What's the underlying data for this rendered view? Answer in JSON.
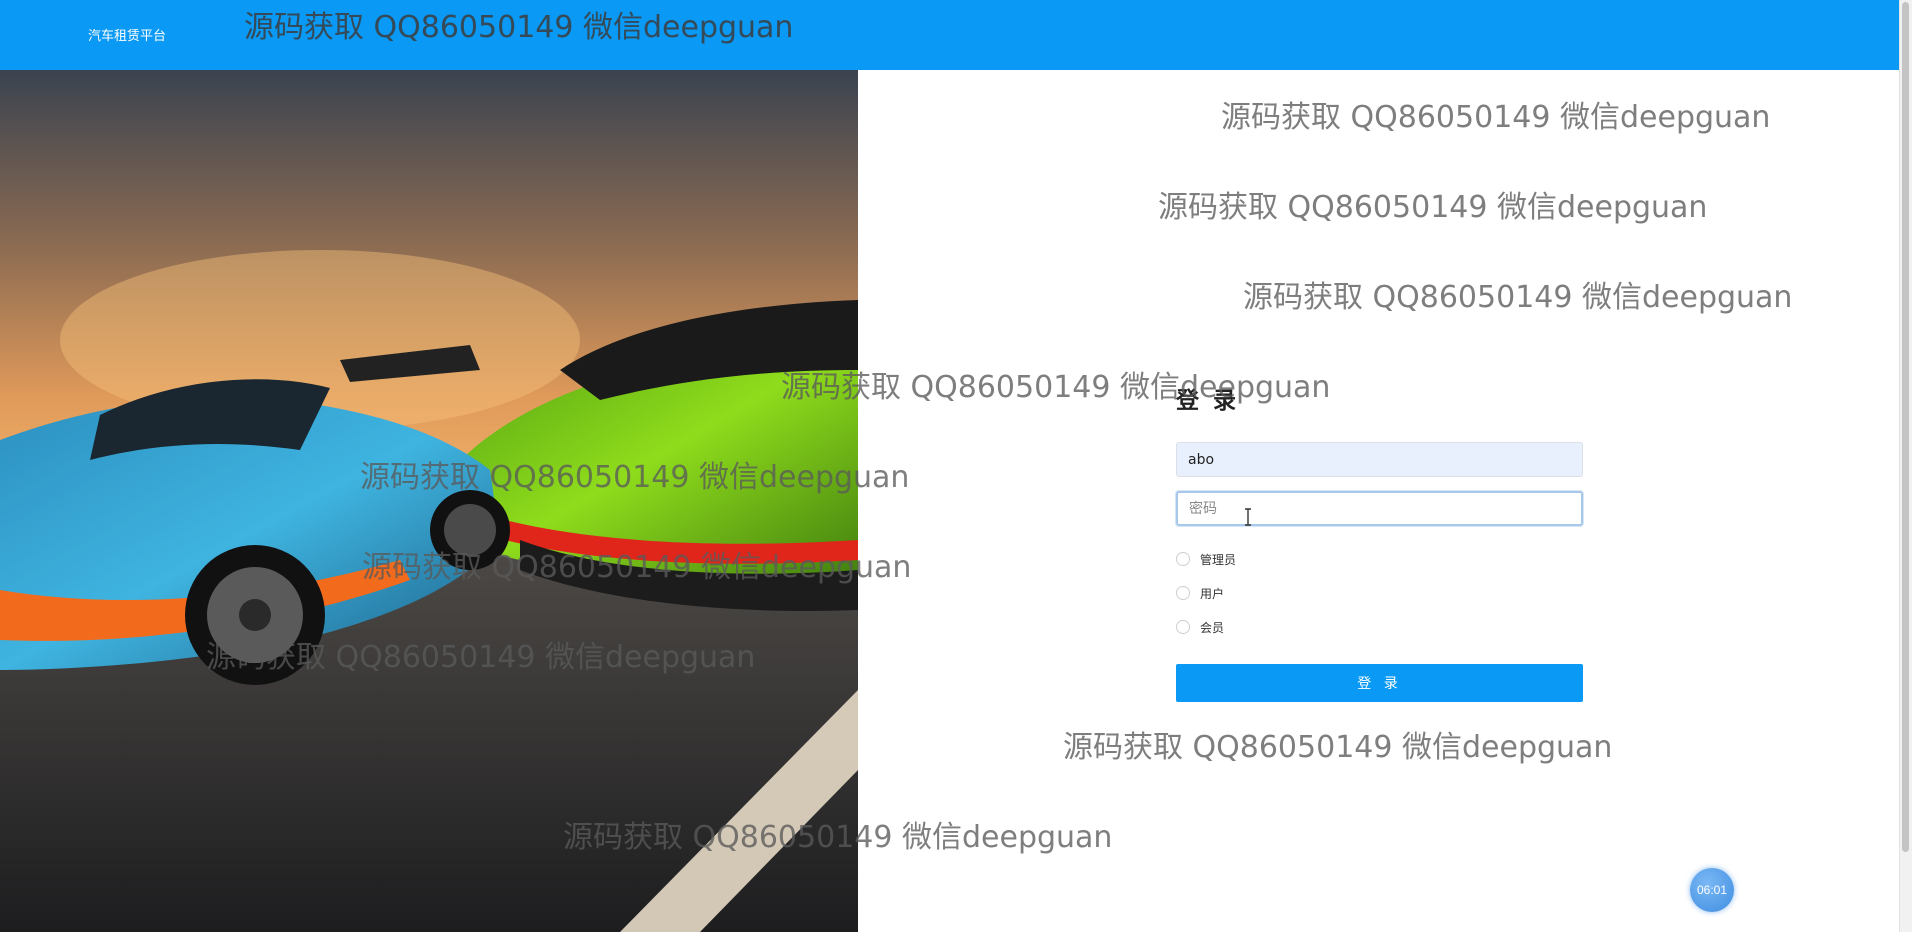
{
  "header": {
    "brand": "汽车租赁平台"
  },
  "login": {
    "title": "登 录",
    "username_value": "abo",
    "password_placeholder": "密码",
    "roles": [
      "管理员",
      "用户",
      "会员"
    ],
    "submit_label": "登 录"
  },
  "watermark": "源码获取 QQ86050149 微信deepguan",
  "timer": "06:01",
  "colors": {
    "primary": "#0a99f4"
  }
}
